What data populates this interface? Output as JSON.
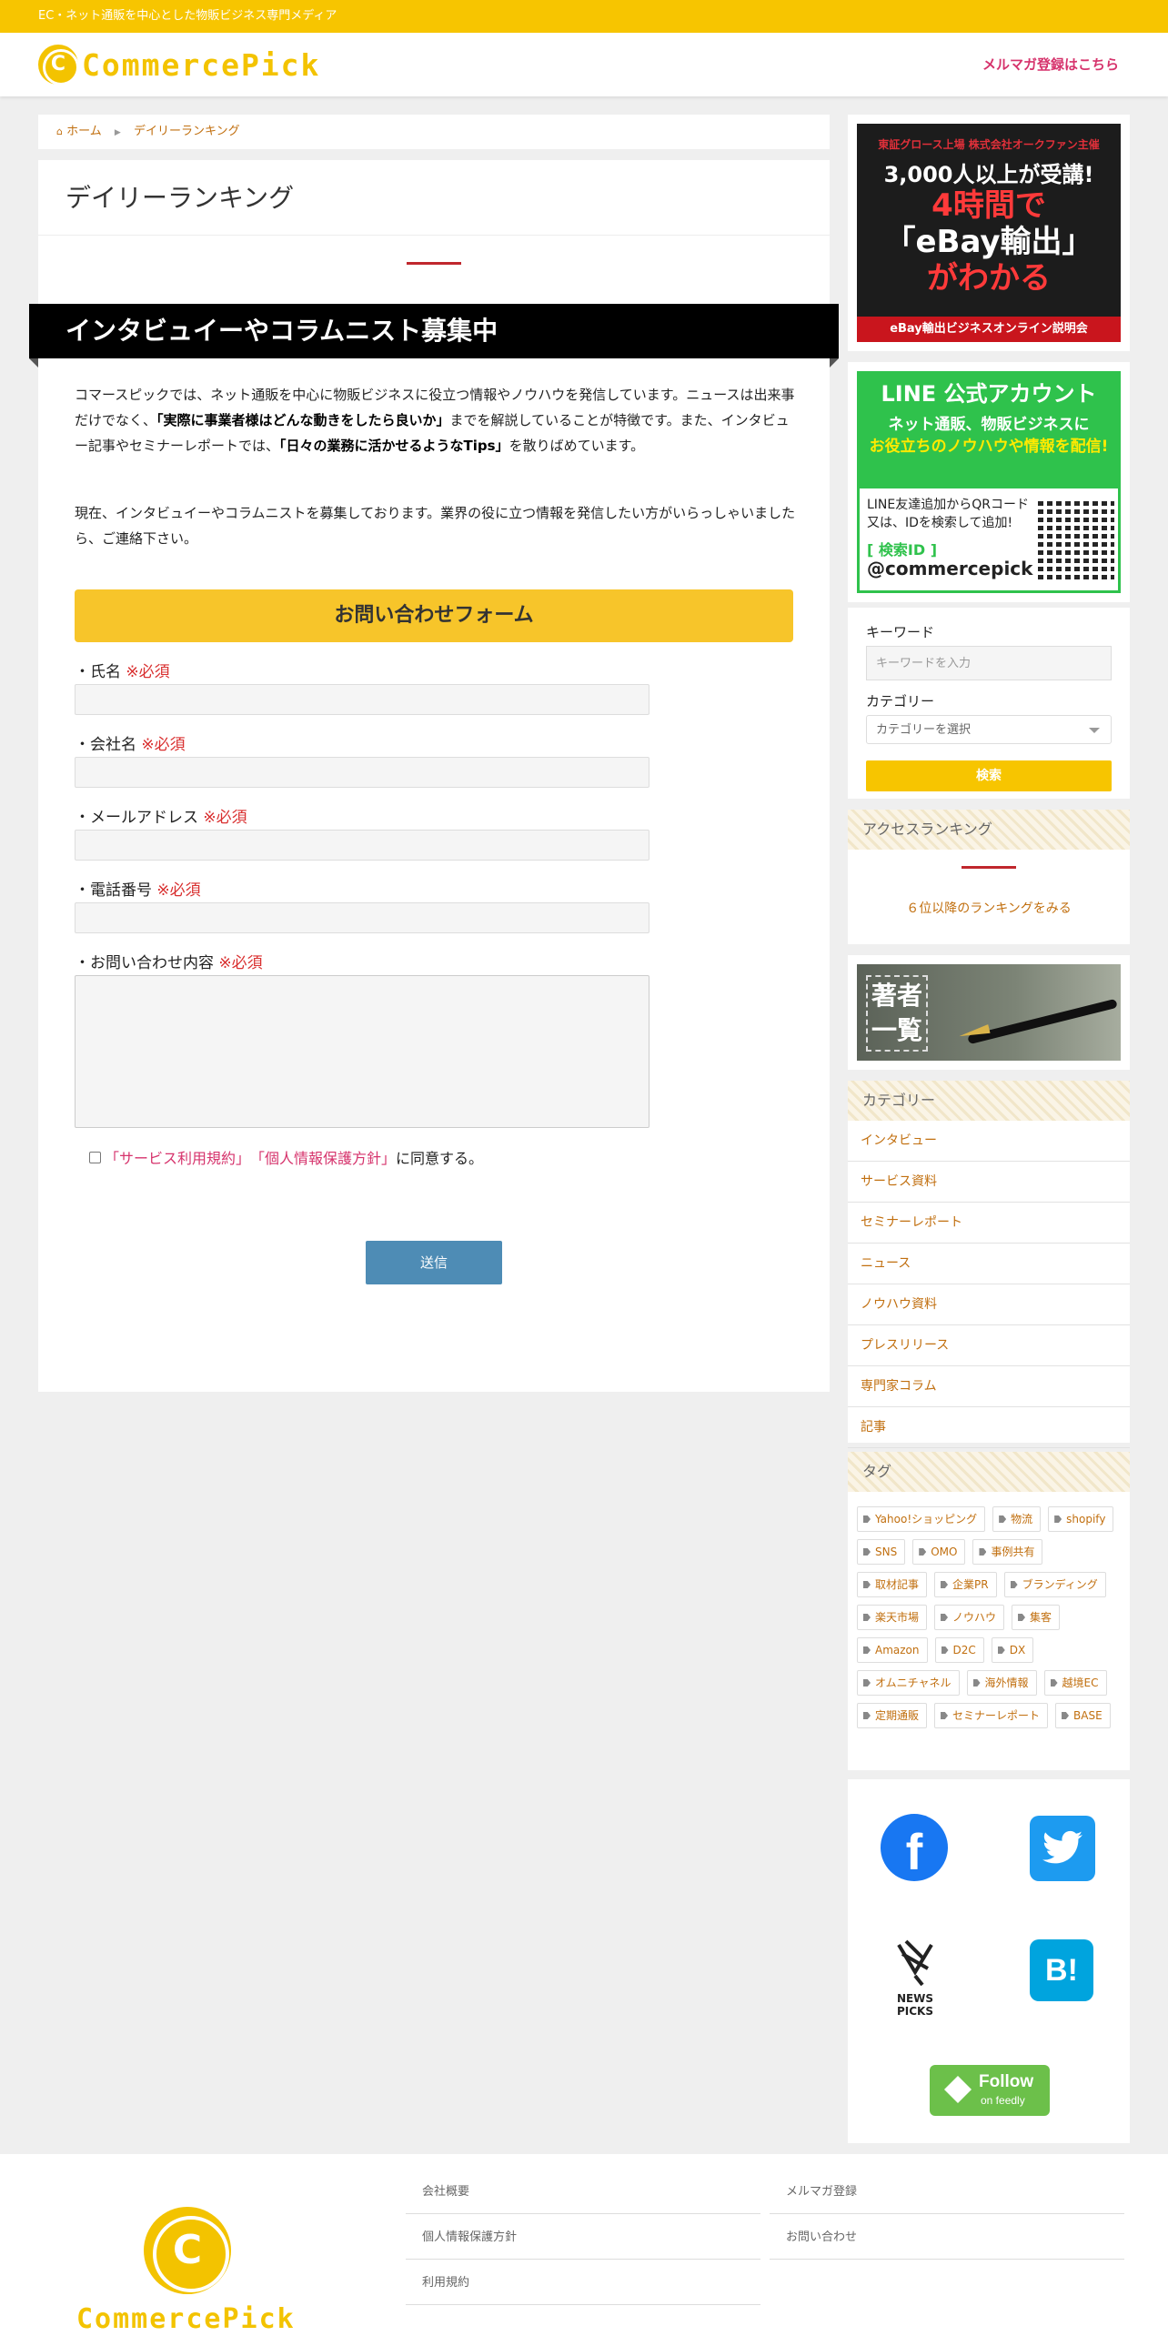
{
  "topbar": {
    "text": "EC・ネット通販を中心とした物販ビジネス専門メディア"
  },
  "header": {
    "logo_text": "CommercePick",
    "logo_mark": "C",
    "mailmag_link": "メルマガ登録はこちら"
  },
  "breadcrumb": {
    "home": "ホーム",
    "current": "デイリーランキング"
  },
  "main": {
    "page_title": "デイリーランキング",
    "banner": "インタビュイーやコラムニスト募集中",
    "para1_a": "コマースピックでは、ネット通販を中心に物販ビジネスに役立つ情報やノウハウを発信しています。ニュースは出来事だけでなく、",
    "para1_b": "「実際に事業者様はどんな動きをしたら良いか」",
    "para1_c": "までを解説していることが特徴です。また、インタビュー記事やセミナーレポートでは、",
    "para1_d": "「日々の業務に活かせるようなTips」",
    "para1_e": "を散りばめています。",
    "para2": "現在、インタビュイーやコラムニストを募集しております。業界の役に立つ情報を発信したい方がいらっしゃいましたら、ご連絡下さい。"
  },
  "form": {
    "header": "お問い合わせフォーム",
    "required": "※必須",
    "fields": [
      {
        "label": "・氏名"
      },
      {
        "label": "・会社名"
      },
      {
        "label": "・メールアドレス"
      },
      {
        "label": "・電話番号"
      },
      {
        "label": "・お問い合わせ内容"
      }
    ],
    "agree_terms": "「サービス利用規約」",
    "agree_privacy": "「個人情報保護方針」",
    "agree_suffix": "に同意する。",
    "submit": "送信"
  },
  "sidebar": {
    "ad1": {
      "line1": "東証グロース上場 株式会社オークファン主催",
      "line2": "3,000人以上が受講!",
      "line3": "4時間で",
      "line4": "「eBay輸出」",
      "line5": "がわかる",
      "line6": "eBay輸出ビジネスオンライン説明会"
    },
    "ad2": {
      "title": "LINE 公式アカウント",
      "line1": "ネット通販、物販ビジネスに",
      "line2": "お役立ちのノウハウや情報を配信!",
      "line3": "LINE友達追加からQRコード",
      "line4": "又は、IDを検索して追加!",
      "id_label": "[ 検索ID ]",
      "id": "@commercepick"
    },
    "search": {
      "keyword_label": "キーワード",
      "keyword_placeholder": "キーワードを入力",
      "category_label": "カテゴリー",
      "category_placeholder": "カテゴリーを選択",
      "button": "検索"
    },
    "ranking": {
      "title": "アクセスランキング",
      "link": "６位以降のランキングをみる"
    },
    "authors_banner": "著者\n一覧",
    "categories": {
      "title": "カテゴリー",
      "items": [
        "インタビュー",
        "サービス資料",
        "セミナーレポート",
        "ニュース",
        "ノウハウ資料",
        "プレスリリース",
        "専門家コラム",
        "記事"
      ]
    },
    "tags": {
      "title": "タグ",
      "items": [
        "Yahoo!ショッピング",
        "物流",
        "shopify",
        "SNS",
        "OMO",
        "事例共有",
        "取材記事",
        "企業PR",
        "ブランディング",
        "楽天市場",
        "ノウハウ",
        "集客",
        "Amazon",
        "D2C",
        "DX",
        "オムニチャネル",
        "海外情報",
        "越境EC",
        "定期通販",
        "セミナーレポート",
        "BASE"
      ]
    },
    "social": {
      "newspicks": "NEWS PICKS",
      "hatena": "B!",
      "feedly_big": "Follow",
      "feedly_small": "on feedly"
    }
  },
  "footer": {
    "logo_text": "CommercePick",
    "nav": [
      "会社概要",
      "個人情報保護方針",
      "利用規約",
      "メルマガ登録",
      "お問い合わせ"
    ]
  }
}
